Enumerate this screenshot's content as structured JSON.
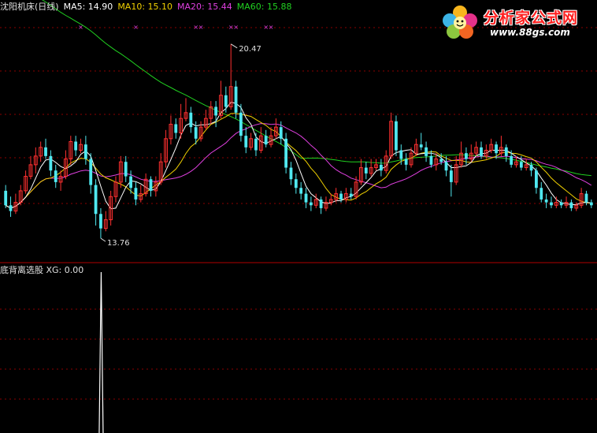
{
  "header": {
    "stock_label": "沈阳机床(日线)",
    "ma5_label": "MA5: 14.90",
    "ma10_label": "MA10: 15.10",
    "ma20_label": "MA20: 15.44",
    "ma60_label": "MA60: 15.88",
    "colors": {
      "stock": "#e0e0e0",
      "ma5": "#ffffff",
      "ma10": "#f0d000",
      "ma20": "#e040e0",
      "ma60": "#20d020"
    }
  },
  "indicator": {
    "label": "底背离选股 XG: 0.00",
    "color": "#ffffff"
  },
  "logo": {
    "title": "分析家公式网",
    "url": "www.88gs.com",
    "icon": "flower-logo-icon"
  },
  "chart_data": {
    "type": "candlestick",
    "price_range": [
      13.0,
      21.5
    ],
    "ylim_indicator": [
      0,
      1
    ],
    "max_label": "20.47",
    "min_label": "13.76",
    "colors": {
      "up": "#ff3030",
      "down": "#50e8f0",
      "ma5": "#ffffff",
      "ma10": "#f0d000",
      "ma20": "#e040e0",
      "ma60": "#20d020",
      "grid": "#8b0000",
      "signal": "#e040e0"
    },
    "candles": [
      [
        15.4,
        14.9,
        15.6,
        14.8
      ],
      [
        14.9,
        14.7,
        15.2,
        14.5
      ],
      [
        14.7,
        15.0,
        15.3,
        14.6
      ],
      [
        15.0,
        15.4,
        15.6,
        14.9
      ],
      [
        15.4,
        15.9,
        16.1,
        15.3
      ],
      [
        15.9,
        16.3,
        16.6,
        15.8
      ],
      [
        16.3,
        16.6,
        16.9,
        16.0
      ],
      [
        16.6,
        16.9,
        17.1,
        16.4
      ],
      [
        16.9,
        16.6,
        17.2,
        16.5
      ],
      [
        16.6,
        16.1,
        16.8,
        15.9
      ],
      [
        16.1,
        15.7,
        16.3,
        15.5
      ],
      [
        15.7,
        15.9,
        16.1,
        15.4
      ],
      [
        15.9,
        16.5,
        16.8,
        15.8
      ],
      [
        16.5,
        17.1,
        17.3,
        16.3
      ],
      [
        17.1,
        16.8,
        17.3,
        16.6
      ],
      [
        16.8,
        17.0,
        17.2,
        16.7
      ],
      [
        17.0,
        16.5,
        17.3,
        16.3
      ],
      [
        16.5,
        15.6,
        16.7,
        15.3
      ],
      [
        15.6,
        14.6,
        15.8,
        14.2
      ],
      [
        14.6,
        14.1,
        14.8,
        13.76
      ],
      [
        14.1,
        14.4,
        14.7,
        14.0
      ],
      [
        14.4,
        15.2,
        15.4,
        14.2
      ],
      [
        15.2,
        15.7,
        15.9,
        15.0
      ],
      [
        15.7,
        16.4,
        16.6,
        15.5
      ],
      [
        16.4,
        15.9,
        16.6,
        15.7
      ],
      [
        15.9,
        15.5,
        16.1,
        15.3
      ],
      [
        15.5,
        15.1,
        15.7,
        14.9
      ],
      [
        15.1,
        15.3,
        15.6,
        15.0
      ],
      [
        15.3,
        15.8,
        16.0,
        15.2
      ],
      [
        15.8,
        15.4,
        15.9,
        15.2
      ],
      [
        15.4,
        15.7,
        15.9,
        15.2
      ],
      [
        15.7,
        16.4,
        16.7,
        15.6
      ],
      [
        16.4,
        17.2,
        17.5,
        16.2
      ],
      [
        17.2,
        17.7,
        18.0,
        17.0
      ],
      [
        17.7,
        17.4,
        17.9,
        17.2
      ],
      [
        17.4,
        17.9,
        18.4,
        17.2
      ],
      [
        17.9,
        18.1,
        18.6,
        17.8
      ],
      [
        18.1,
        17.6,
        18.3,
        17.4
      ],
      [
        17.6,
        17.2,
        17.8,
        17.0
      ],
      [
        17.2,
        17.6,
        17.8,
        17.1
      ],
      [
        17.6,
        17.9,
        18.2,
        17.5
      ],
      [
        17.9,
        18.3,
        18.5,
        17.7
      ],
      [
        18.3,
        18.0,
        18.5,
        17.6
      ],
      [
        18.0,
        18.7,
        19.2,
        17.9
      ],
      [
        18.7,
        18.3,
        19.0,
        18.1
      ],
      [
        18.3,
        19.0,
        20.47,
        18.2
      ],
      [
        19.0,
        18.1,
        19.2,
        17.9
      ],
      [
        18.1,
        17.3,
        18.4,
        17.1
      ],
      [
        17.3,
        16.9,
        17.6,
        16.7
      ],
      [
        16.9,
        17.2,
        17.4,
        16.8
      ],
      [
        17.2,
        16.8,
        17.4,
        16.6
      ],
      [
        16.8,
        17.3,
        17.6,
        16.7
      ],
      [
        17.3,
        17.0,
        17.5,
        16.9
      ],
      [
        17.0,
        17.3,
        17.6,
        16.9
      ],
      [
        17.3,
        17.6,
        17.9,
        17.2
      ],
      [
        17.6,
        17.2,
        17.8,
        17.0
      ],
      [
        17.2,
        16.2,
        17.4,
        16.0
      ],
      [
        16.2,
        15.8,
        16.4,
        15.6
      ],
      [
        15.8,
        15.5,
        16.0,
        15.3
      ],
      [
        15.5,
        15.3,
        15.7,
        15.1
      ],
      [
        15.3,
        15.0,
        15.5,
        14.8
      ],
      [
        15.0,
        14.9,
        15.2,
        14.7
      ],
      [
        14.9,
        15.1,
        15.3,
        14.8
      ],
      [
        15.1,
        14.8,
        15.2,
        14.6
      ],
      [
        14.8,
        15.0,
        15.2,
        14.7
      ],
      [
        15.0,
        15.1,
        15.3,
        14.9
      ],
      [
        15.1,
        15.3,
        15.5,
        15.0
      ],
      [
        15.3,
        15.1,
        15.4,
        15.0
      ],
      [
        15.1,
        15.3,
        15.5,
        15.0
      ],
      [
        15.3,
        15.2,
        15.5,
        15.1
      ],
      [
        15.2,
        15.7,
        15.9,
        15.1
      ],
      [
        15.7,
        16.2,
        16.5,
        15.6
      ],
      [
        16.2,
        16.0,
        16.4,
        15.8
      ],
      [
        16.0,
        16.2,
        16.5,
        15.9
      ],
      [
        16.2,
        16.3,
        16.5,
        16.1
      ],
      [
        16.3,
        16.1,
        16.5,
        15.9
      ],
      [
        16.1,
        16.6,
        16.8,
        16.0
      ],
      [
        16.6,
        17.8,
        18.1,
        16.5
      ],
      [
        17.8,
        16.8,
        18.0,
        16.6
      ],
      [
        16.8,
        16.5,
        17.0,
        16.3
      ],
      [
        16.5,
        16.3,
        16.7,
        16.1
      ],
      [
        16.3,
        16.7,
        16.9,
        16.2
      ],
      [
        16.7,
        17.0,
        17.2,
        16.6
      ],
      [
        17.0,
        16.9,
        17.4,
        16.8
      ],
      [
        16.9,
        16.6,
        17.1,
        16.4
      ],
      [
        16.6,
        16.3,
        16.8,
        16.2
      ],
      [
        16.3,
        16.5,
        16.7,
        16.1
      ],
      [
        16.5,
        16.4,
        16.7,
        16.3
      ],
      [
        16.4,
        16.1,
        16.6,
        15.9
      ],
      [
        16.1,
        15.7,
        16.3,
        15.2
      ],
      [
        15.7,
        16.3,
        16.6,
        15.6
      ],
      [
        16.3,
        16.7,
        17.1,
        16.2
      ],
      [
        16.7,
        16.5,
        16.9,
        16.3
      ],
      [
        16.5,
        16.7,
        17.0,
        16.4
      ],
      [
        16.7,
        16.9,
        17.1,
        16.6
      ],
      [
        16.9,
        16.6,
        17.1,
        16.5
      ],
      [
        16.6,
        16.8,
        17.0,
        16.5
      ],
      [
        16.8,
        17.0,
        17.2,
        16.7
      ],
      [
        17.0,
        16.7,
        17.1,
        16.5
      ],
      [
        16.7,
        16.9,
        17.3,
        16.6
      ],
      [
        16.9,
        16.6,
        17.0,
        16.4
      ],
      [
        16.6,
        16.3,
        16.8,
        16.2
      ],
      [
        16.3,
        16.4,
        16.6,
        16.2
      ],
      [
        16.4,
        16.2,
        16.6,
        16.1
      ],
      [
        16.2,
        16.3,
        16.5,
        16.1
      ],
      [
        16.3,
        16.1,
        16.4,
        15.9
      ],
      [
        16.1,
        15.5,
        16.2,
        15.3
      ],
      [
        15.5,
        15.1,
        15.7,
        15.0
      ],
      [
        15.1,
        15.0,
        15.3,
        14.8
      ],
      [
        15.0,
        14.9,
        15.2,
        14.8
      ],
      [
        14.9,
        15.0,
        15.2,
        14.8
      ],
      [
        15.0,
        14.9,
        15.1,
        14.8
      ],
      [
        14.9,
        15.0,
        15.2,
        14.8
      ],
      [
        15.0,
        14.8,
        15.1,
        14.7
      ],
      [
        14.8,
        14.9,
        15.0,
        14.7
      ],
      [
        14.9,
        15.3,
        15.5,
        14.8
      ],
      [
        15.3,
        15.0,
        15.4,
        14.9
      ],
      [
        15.0,
        14.9,
        15.1,
        14.8
      ]
    ],
    "ma60_start": 23.0,
    "signal_marker_indices": [
      15,
      26,
      38,
      39,
      45,
      46,
      52,
      53
    ]
  }
}
